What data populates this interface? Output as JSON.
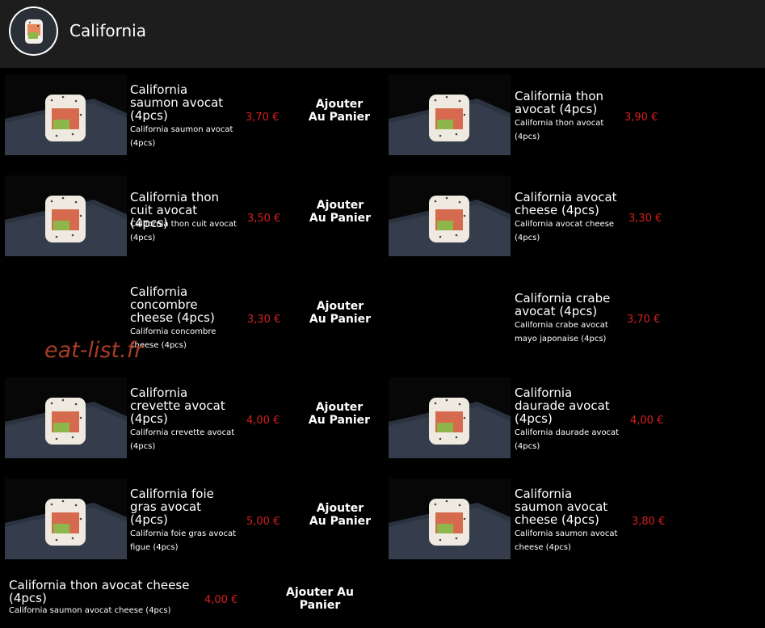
{
  "header": {
    "title": "California",
    "avatar_icon": "sushi-roll-icon"
  },
  "watermark": "eat-list.fr",
  "add_label": "Ajouter Au Panier",
  "colors": {
    "price": "#d81e1e",
    "header_bg": "#1d1d1d",
    "background": "#000000"
  },
  "items": [
    {
      "name": "California saumon avocat (4pcs)",
      "description": "California saumon avocat (4pcs)",
      "price": "3,70 €",
      "add": "Ajouter Au Panier"
    },
    {
      "name": "California thon avocat (4pcs)",
      "description": "California thon avocat (4pcs)",
      "price": "3,90 €",
      "add": "Ajouter Au Panier"
    },
    {
      "name": "California thon cuit avocat (4pcs)",
      "description": "California thon cuit avocat (4pcs)",
      "price": "3,50 €",
      "add": "Ajouter Au Panier"
    },
    {
      "name": "California avocat cheese (4pcs)",
      "description": "California avocat cheese (4pcs)",
      "price": "3,30 €",
      "add": "Ajouter Au Panier"
    },
    {
      "name": "California concombre cheese (4pcs)",
      "description": "California concombre cheese (4pcs)",
      "price": "3,30 €",
      "add": "Ajouter Au Panier"
    },
    {
      "name": "California crabe avocat (4pcs)",
      "description": "California crabe avocat mayo japonaise (4pcs)",
      "price": "3,70 €",
      "add": "Ajouter Au Panier"
    },
    {
      "name": "California crevette avocat (4pcs)",
      "description": "California crevette avocat (4pcs)",
      "price": "4,00 €",
      "add": "Ajouter Au Panier"
    },
    {
      "name": "California daurade avocat (4pcs)",
      "description": "California daurade avocat (4pcs)",
      "price": "4,00 €",
      "add": "Ajouter Au Panier"
    },
    {
      "name": "California foie gras avocat (4pcs)",
      "description": "California foie gras avocat figue (4pcs)",
      "price": "5,00 €",
      "add": "Ajouter Au Panier"
    },
    {
      "name": "California saumon avocat cheese (4pcs)",
      "description": "California saumon avocat cheese (4pcs)",
      "price": "3,80 €",
      "add": "Ajouter Au Panier"
    },
    {
      "name": "California thon avocat cheese (4pcs)",
      "description": "California saumon avocat cheese (4pcs)",
      "price": "4,00 €",
      "add": "Ajouter Au Panier"
    }
  ]
}
